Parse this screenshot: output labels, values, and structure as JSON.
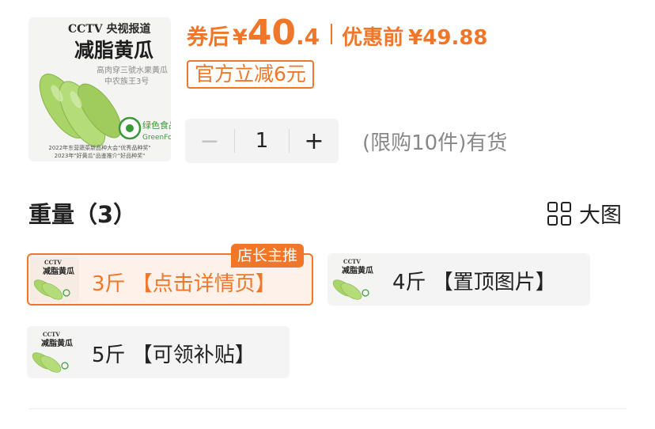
{
  "product": {
    "image": {
      "brand": "CCTV 央视报道",
      "title": "减脂黄瓜",
      "subtitle_1": "高肉穿三號水果黃瓜",
      "subtitle_2": "中农族王3号",
      "green_label": "绿色食品",
      "green_label_en": "GreenFood",
      "award_1": "2022年东营蔬菜新品种大会\"优秀品种奖\"",
      "award_2": "2023年\"好黄瓜\"品鉴推介\"好品种奖\""
    }
  },
  "price": {
    "after_coupon_label": "券后",
    "currency": "¥",
    "integer": "40",
    "decimal": ".4",
    "original_label": "优惠前",
    "original_price": "¥49.88",
    "coupon_text": "官方立减6元"
  },
  "quantity": {
    "minus": "−",
    "value": "1",
    "plus": "+",
    "stock_text": "(限购10件)有货"
  },
  "weight": {
    "title": "重量（3）",
    "big_image_label": "大图",
    "options": [
      {
        "label": "3斤 【点击详情页】",
        "badge": "店长主推",
        "selected": true
      },
      {
        "label": "4斤 【置顶图片】",
        "selected": false
      },
      {
        "label": "5斤 【可领补贴】",
        "selected": false
      }
    ]
  },
  "colors": {
    "accent": "#f0772a",
    "cucumber": "#9ccc5a"
  }
}
